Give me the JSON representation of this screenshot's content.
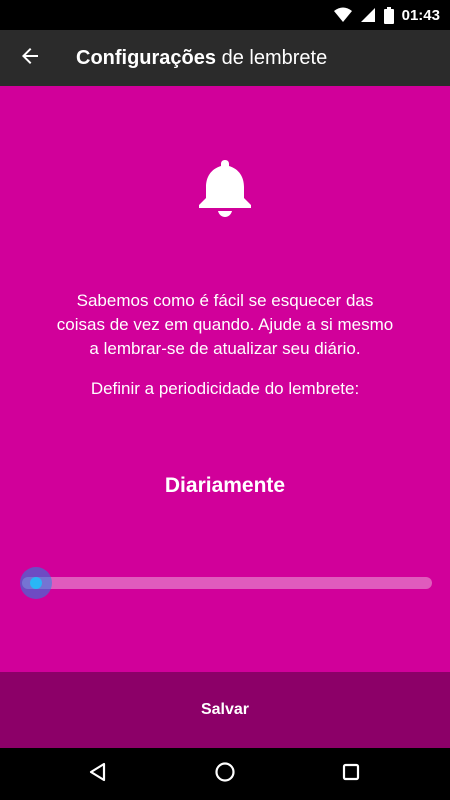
{
  "status_bar": {
    "time": "01:43",
    "icons": [
      "wifi-icon",
      "cell-signal-icon",
      "battery-icon"
    ]
  },
  "app_bar": {
    "title_bold": "Configurações",
    "title_rest": " de lembrete",
    "back_icon": "arrow-back-icon"
  },
  "content": {
    "icon": "bell-icon",
    "description": "Sabemos como é fácil se esquecer das\ncoisas de vez em quando. Ajude a si mesmo\na lembrar-se de atualizar seu diário.",
    "periodicity_label": "Definir a periodicidade do lembrete:",
    "frequency_value": "Diariamente",
    "slider_position": 0
  },
  "save": {
    "label": "Salvar"
  },
  "nav_bar": {
    "icons": [
      "back-triangle-icon",
      "home-circle-icon",
      "recents-square-icon"
    ]
  },
  "colors": {
    "accent": "#d1009a",
    "save_bar": "#8c0068",
    "app_bar": "#2b2b2b",
    "slider_thumb": "#29b6f6"
  }
}
